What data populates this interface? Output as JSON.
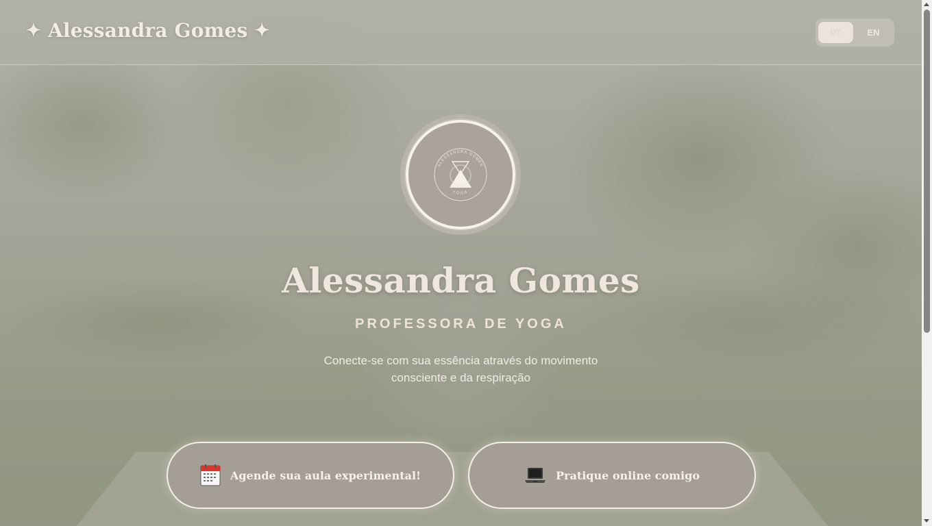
{
  "header": {
    "brand_left_icon": "sparkle-icon",
    "brand_name": "Alessandra Gomes",
    "brand_right_icon": "sparkle-icon",
    "languages": [
      {
        "label": "PT",
        "active": true
      },
      {
        "label": "EN",
        "active": false
      }
    ]
  },
  "hero": {
    "logo": {
      "icon": "hourglass-mountain-logo",
      "ring_text_top": "ALESSANDRA GOMES",
      "ring_text_bottom": "YOGA"
    },
    "title": "Alessandra Gomes",
    "subtitle": "PROFESSORA DE YOGA",
    "tagline": "Conecte-se com sua essência através do movimento consciente e da respiração"
  },
  "cta": {
    "trial": {
      "icon": "calendar-icon",
      "label": "Agende sua aula experimental!"
    },
    "online": {
      "icon": "laptop-icon",
      "label": "Pratique online comigo"
    }
  },
  "colors": {
    "text_light": "#efe7de",
    "button_fill": "#a49e94",
    "button_border": "#f4efe8",
    "calendar_red": "#d9352b"
  }
}
